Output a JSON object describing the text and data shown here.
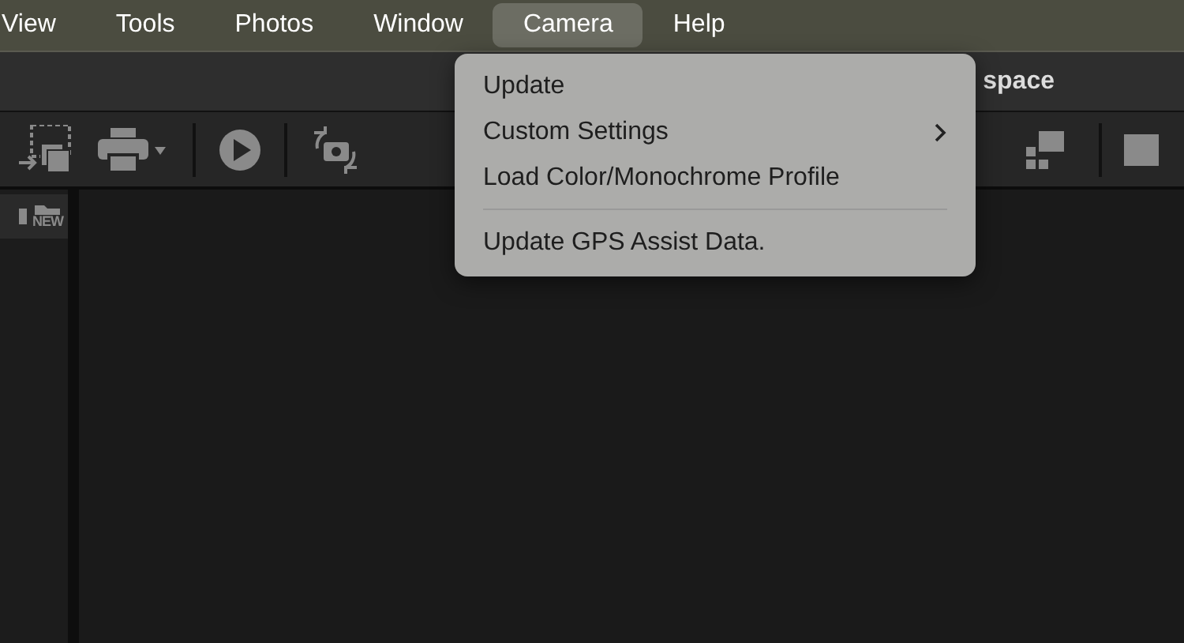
{
  "menubar": [
    {
      "label": "View",
      "selected": false
    },
    {
      "label": "Tools",
      "selected": false
    },
    {
      "label": "Photos",
      "selected": false
    },
    {
      "label": "Window",
      "selected": false
    },
    {
      "label": "Camera",
      "selected": true
    },
    {
      "label": "Help",
      "selected": false
    }
  ],
  "window": {
    "title": "space"
  },
  "sidebar": {
    "new_folder_label": "NEW"
  },
  "dropdown": [
    {
      "kind": "item",
      "label": "Update"
    },
    {
      "kind": "submenu",
      "label": "Custom Settings"
    },
    {
      "kind": "item",
      "label": "Load Color/Monochrome Profile"
    },
    {
      "kind": "separator"
    },
    {
      "kind": "item",
      "label": "Update GPS Assist Data."
    }
  ]
}
